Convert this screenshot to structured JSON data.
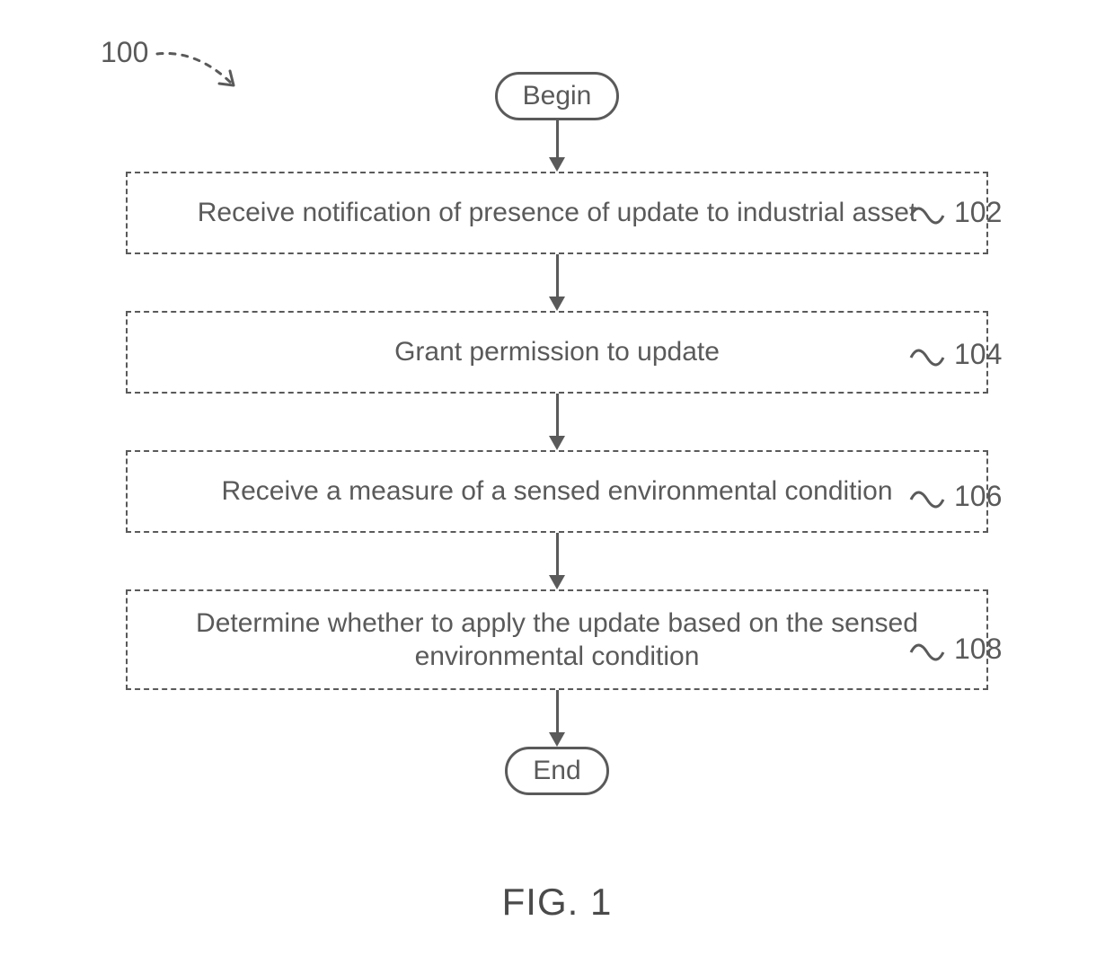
{
  "figure_ref": "100",
  "terminator_begin": "Begin",
  "terminator_end": "End",
  "steps": [
    {
      "ref": "102",
      "text": "Receive notification of presence of update to industrial asset"
    },
    {
      "ref": "104",
      "text": "Grant permission to update"
    },
    {
      "ref": "106",
      "text": "Receive a measure of a sensed environmental condition"
    },
    {
      "ref": "108",
      "text": "Determine whether to apply the update based on the sensed environmental condition"
    }
  ],
  "figure_label": "FIG. 1"
}
